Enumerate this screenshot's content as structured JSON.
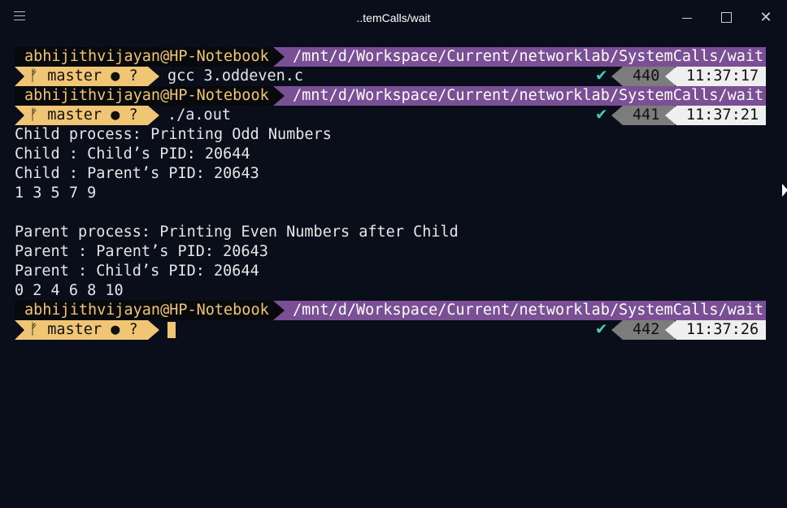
{
  "window": {
    "title": "..temCalls/wait",
    "colors": {
      "background": "#0a0e1b",
      "user": "#f0c674",
      "path": "#7b4f95",
      "git": "#f0c674",
      "history": "#7c7c7c",
      "time": "#efefef",
      "check": "#3fd2b3"
    }
  },
  "prompts": [
    {
      "user": "abhijithvijayan@HP-Notebook",
      "path": "/mnt/d/Workspace/Current/networklab/SystemCalls/wait",
      "git": "master ● ?",
      "command": "gcc 3.oddeven.c",
      "status": "✔",
      "history": "440",
      "time": "11:37:17"
    },
    {
      "user": "abhijithvijayan@HP-Notebook",
      "path": "/mnt/d/Workspace/Current/networklab/SystemCalls/wait",
      "git": "master ● ?",
      "command": "./a.out",
      "status": "✔",
      "history": "441",
      "time": "11:37:21"
    },
    {
      "user": "abhijithvijayan@HP-Notebook",
      "path": "/mnt/d/Workspace/Current/networklab/SystemCalls/wait",
      "git": "master ● ?",
      "command": "",
      "status": "✔",
      "history": "442",
      "time": "11:37:26"
    }
  ],
  "output": [
    "Child process: Printing Odd Numbers",
    "Child : Child’s PID: 20644",
    "Child : Parent’s PID: 20643",
    "1 3 5 7 9",
    "",
    "Parent process: Printing Even Numbers after Child",
    "Parent : Parent’s PID: 20643",
    "Parent : Child’s PID: 20644",
    "0 2 4 6 8 10"
  ]
}
